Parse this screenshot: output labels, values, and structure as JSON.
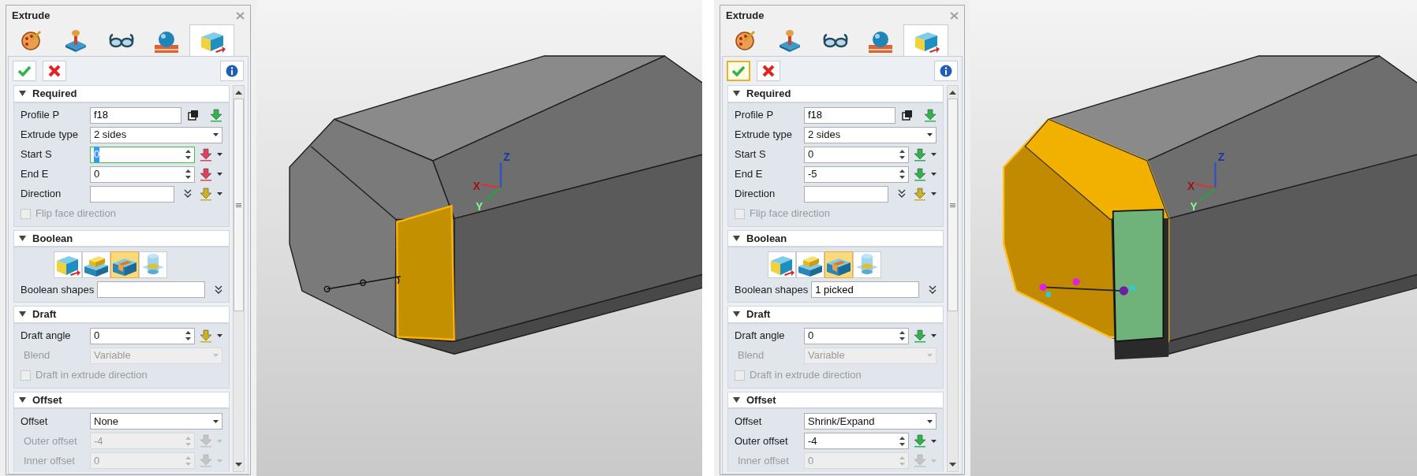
{
  "screenshots": [
    {
      "panel": {
        "title": "Extrude",
        "tabs": [
          {
            "selected": false
          },
          {
            "selected": false
          },
          {
            "selected": false
          },
          {
            "selected": false
          },
          {
            "selected": true
          }
        ],
        "ok_focused": false,
        "sections": [
          {
            "title": "Required",
            "expanded": true,
            "rows": [
              {
                "kind": "pick",
                "label": "Profile P",
                "value": "f18",
                "color": "#2fb44a"
              },
              {
                "kind": "dropdown",
                "label": "Extrude type",
                "value": "2 sides",
                "disabled": false
              },
              {
                "kind": "spin",
                "label": "Start S",
                "value": "0",
                "focused": true,
                "disabled": false,
                "color": "#e0405a"
              },
              {
                "kind": "spin",
                "label": "End E",
                "value": "0",
                "focused": false,
                "disabled": false,
                "color": "#e0405a"
              },
              {
                "kind": "direction",
                "label": "Direction",
                "color": "#cdb21e"
              },
              {
                "kind": "checkbox",
                "label": "Flip face direction",
                "checked": false,
                "disabled": true
              }
            ]
          },
          {
            "title": "Boolean",
            "expanded": true,
            "rows": [
              {
                "kind": "buttons",
                "options": [
                  {
                    "selected": false
                  },
                  {
                    "selected": false
                  },
                  {
                    "selected": true
                  },
                  {
                    "selected": false
                  }
                ]
              },
              {
                "kind": "list",
                "label": "Boolean shapes"
              }
            ]
          },
          {
            "title": "Draft",
            "expanded": true,
            "rows": [
              {
                "kind": "spin",
                "label": "Draft angle",
                "value": "0",
                "focused": false,
                "disabled": false,
                "color": "#cdb21e"
              },
              {
                "kind": "dropdown",
                "label": "Blend",
                "value": "Variable",
                "disabled": true
              },
              {
                "kind": "checkbox",
                "label": "Draft in extrude direction",
                "checked": false,
                "disabled": true
              }
            ]
          },
          {
            "title": "Offset",
            "expanded": true,
            "rows": [
              {
                "kind": "dropdown",
                "label": "Offset",
                "value": "None",
                "disabled": false
              },
              {
                "kind": "spin",
                "label": "Outer offset",
                "value": "-4",
                "focused": false,
                "disabled": true
              },
              {
                "kind": "spin",
                "label": "Inner offset",
                "value": "0",
                "focused": false,
                "disabled": true
              }
            ]
          }
        ]
      },
      "viewport": {
        "kind": "selected_face",
        "axes": [
          "X",
          "Y",
          "Z"
        ]
      }
    },
    {
      "panel": {
        "title": "Extrude",
        "tabs": [
          {
            "selected": false
          },
          {
            "selected": false
          },
          {
            "selected": false
          },
          {
            "selected": false
          },
          {
            "selected": true
          }
        ],
        "ok_focused": true,
        "sections": [
          {
            "title": "Required",
            "expanded": true,
            "rows": [
              {
                "kind": "pick",
                "label": "Profile P",
                "value": "f18",
                "color": "#2fb44a"
              },
              {
                "kind": "dropdown",
                "label": "Extrude type",
                "value": "2 sides",
                "disabled": false
              },
              {
                "kind": "spin",
                "label": "Start S",
                "value": "0",
                "focused": false,
                "disabled": false,
                "color": "#2fb44a"
              },
              {
                "kind": "spin",
                "label": "End E",
                "value": "-5",
                "focused": false,
                "disabled": false,
                "color": "#2fb44a"
              },
              {
                "kind": "direction",
                "label": "Direction",
                "color": "#cdb21e"
              },
              {
                "kind": "checkbox",
                "label": "Flip face direction",
                "checked": false,
                "disabled": true
              }
            ]
          },
          {
            "title": "Boolean",
            "expanded": true,
            "rows": [
              {
                "kind": "buttons",
                "options": [
                  {
                    "selected": false
                  },
                  {
                    "selected": false
                  },
                  {
                    "selected": true
                  },
                  {
                    "selected": false
                  }
                ]
              },
              {
                "kind": "list",
                "label": "Boolean shapes",
                "value": "1 picked"
              }
            ]
          },
          {
            "title": "Draft",
            "expanded": true,
            "rows": [
              {
                "kind": "spin",
                "label": "Draft angle",
                "value": "0",
                "focused": false,
                "disabled": false,
                "color": "#2fb44a"
              },
              {
                "kind": "dropdown",
                "label": "Blend",
                "value": "Variable",
                "disabled": true
              },
              {
                "kind": "checkbox",
                "label": "Draft in extrude direction",
                "checked": false,
                "disabled": true
              }
            ]
          },
          {
            "title": "Offset",
            "expanded": true,
            "rows": [
              {
                "kind": "dropdown",
                "label": "Offset",
                "value": "Shrink/Expand",
                "disabled": false
              },
              {
                "kind": "spin",
                "label": "Outer offset",
                "value": "-4",
                "focused": false,
                "disabled": false,
                "color": "#2fb44a"
              },
              {
                "kind": "spin",
                "label": "Inner offset",
                "value": "0",
                "focused": false,
                "disabled": true
              }
            ]
          }
        ]
      },
      "viewport": {
        "kind": "offset_preview",
        "axes": [
          "X",
          "Y",
          "Z"
        ]
      }
    }
  ]
}
